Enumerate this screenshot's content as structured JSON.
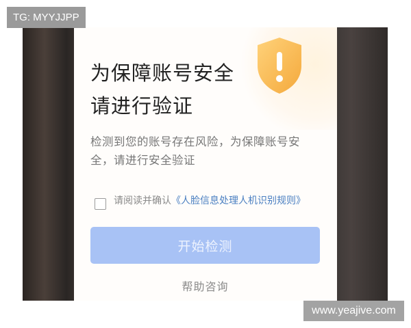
{
  "watermarks": {
    "top_left": "TG: MYYJJPP",
    "bottom_right": "www.yeajive.com"
  },
  "verification": {
    "title_line1": "为保障账号安全",
    "title_line2": "请进行验证",
    "description": "检测到您的账号存在风险，为保障账号安全，请进行安全验证",
    "shield_icon": "shield-warning-icon",
    "agreement": {
      "checked": false,
      "prefix": "请阅读并确认",
      "link_text": "《人脸信息处理人机识别规则》"
    },
    "start_button": "开始检测",
    "help_link": "帮助咨询"
  },
  "colors": {
    "button": "#a8c2f5",
    "link": "#4a7fc1",
    "shield": "#f6b84a"
  }
}
